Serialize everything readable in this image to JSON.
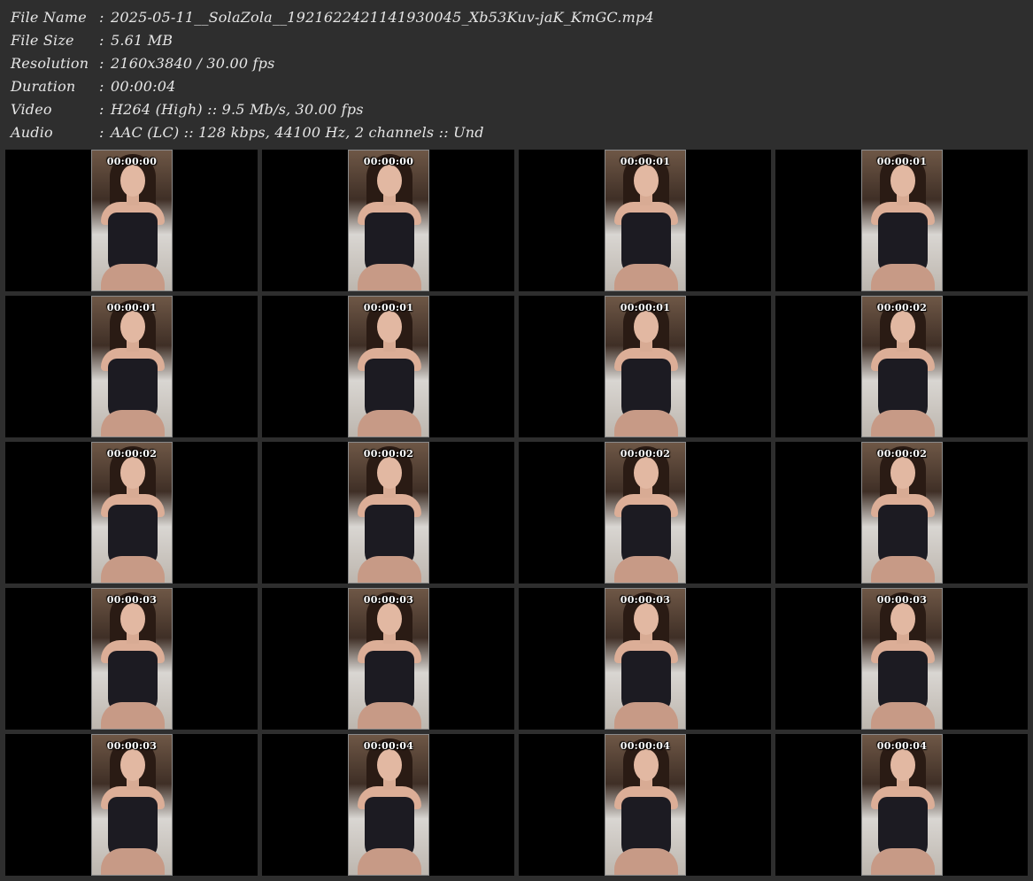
{
  "info": [
    {
      "label": "File Name",
      "sep": ":",
      "value": "2025-05-11__SolaZola__1921622421141930045_Xb53Kuv-jaK_KmGC.mp4"
    },
    {
      "label": "File Size",
      "sep": ":",
      "value": "5.61 MB"
    },
    {
      "label": "Resolution",
      "sep": ":",
      "value": "2160x3840 / 30.00 fps"
    },
    {
      "label": "Duration",
      "sep": ":",
      "value": "00:00:04"
    },
    {
      "label": "Video",
      "sep": ":",
      "value": "H264 (High) :: 9.5 Mb/s, 30.00 fps"
    },
    {
      "label": "Audio",
      "sep": ":",
      "value": "AAC (LC) :: 128 kbps, 44100 Hz, 2 channels :: Und"
    }
  ],
  "thumbnails": [
    "00:00:00",
    "00:00:00",
    "00:00:01",
    "00:00:01",
    "00:00:01",
    "00:00:01",
    "00:00:01",
    "00:00:02",
    "00:00:02",
    "00:00:02",
    "00:00:02",
    "00:00:02",
    "00:00:03",
    "00:00:03",
    "00:00:03",
    "00:00:03",
    "00:00:03",
    "00:00:04",
    "00:00:04",
    "00:00:04"
  ]
}
